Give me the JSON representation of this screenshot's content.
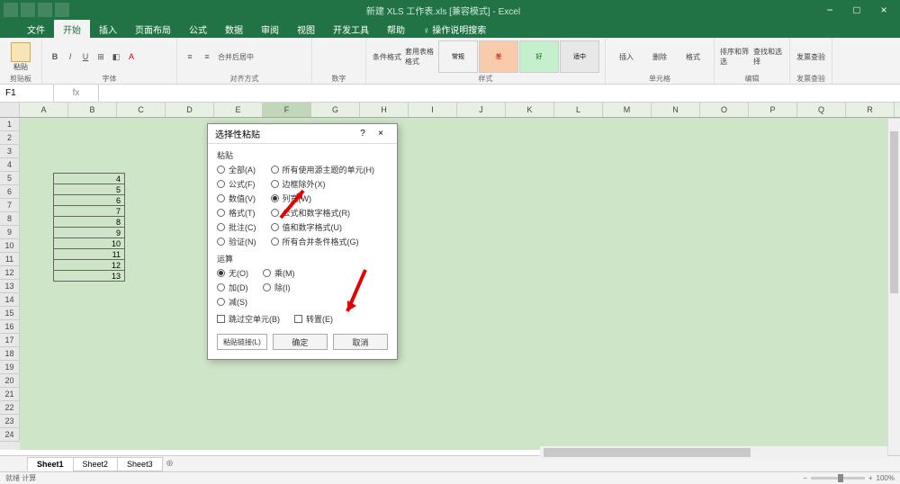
{
  "titlebar": {
    "doc_title": "新建 XLS 工作表.xls [兼容模式] - Excel"
  },
  "window": {
    "min": "−",
    "max": "□",
    "close": "×"
  },
  "tabs": [
    "文件",
    "开始",
    "插入",
    "页面布局",
    "公式",
    "数据",
    "审阅",
    "视图",
    "开发工具",
    "帮助",
    "♀ 操作说明搜索"
  ],
  "active_tab": 1,
  "ribbon": {
    "clipboard": {
      "paste": "粘贴",
      "label": "剪贴板"
    },
    "font": {
      "label": "字体",
      "bold": "B",
      "italic": "I",
      "underline": "U"
    },
    "align": {
      "label": "对齐方式",
      "merge": "合并后居中"
    },
    "number": {
      "label": "数字"
    },
    "styles": {
      "cond": "条件格式",
      "fmt_table": "套用表格格式",
      "label": "样式",
      "cells": [
        "常规",
        "差",
        "好",
        "适中"
      ]
    },
    "cells_grp": {
      "insert": "插入",
      "delete": "删除",
      "format": "格式",
      "label": "单元格"
    },
    "editing": {
      "sort": "排序和筛选",
      "find": "查找和选择",
      "label": "编辑"
    },
    "addin": {
      "btn": "发票查验",
      "label": "发票查验"
    }
  },
  "namebox": "F1",
  "fx": "fx",
  "columns": [
    "A",
    "B",
    "C",
    "D",
    "E",
    "F",
    "G",
    "H",
    "I",
    "J",
    "K",
    "L",
    "M",
    "N",
    "O",
    "P",
    "Q",
    "R"
  ],
  "rows": [
    "1",
    "2",
    "3",
    "4",
    "5",
    "6",
    "7",
    "8",
    "9",
    "10",
    "11",
    "12",
    "13",
    "14",
    "15",
    "16",
    "17",
    "18",
    "19",
    "20",
    "21",
    "22",
    "23",
    "24"
  ],
  "table_data": [
    "4",
    "5",
    "6",
    "7",
    "8",
    "9",
    "10",
    "11",
    "12",
    "13"
  ],
  "dialog": {
    "title": "选择性粘贴",
    "help": "?",
    "close": "×",
    "sec1": "粘贴",
    "left1": [
      "全部(A)",
      "公式(F)",
      "数值(V)",
      "格式(T)",
      "批注(C)",
      "验证(N)"
    ],
    "right1": [
      "所有使用源主题的单元(H)",
      "边框除外(X)",
      "列宽(W)",
      "公式和数字格式(R)",
      "值和数字格式(U)",
      "所有合并条件格式(G)"
    ],
    "right1_sel": 2,
    "sec2": "运算",
    "left2": [
      "无(O)",
      "加(D)",
      "减(S)"
    ],
    "right2": [
      "乘(M)",
      "除(I)"
    ],
    "left2_sel": 0,
    "skip": "跳过空单元(B)",
    "transpose": "转置(E)",
    "link": "粘贴链接(L)",
    "ok": "确定",
    "cancel": "取消"
  },
  "sheets": [
    "Sheet1",
    "Sheet2",
    "Sheet3"
  ],
  "sheet_plus": "⊕",
  "status": {
    "ready": "就绪  计算",
    "zoom": "100%"
  }
}
